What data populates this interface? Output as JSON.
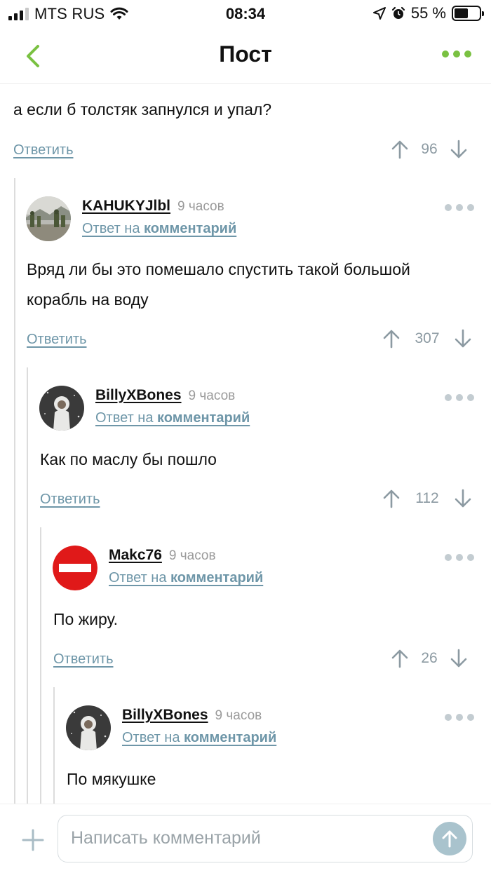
{
  "status_bar": {
    "carrier": "MTS RUS",
    "time": "08:34",
    "battery": "55 %",
    "battery_level": 0.55
  },
  "nav": {
    "title": "Пост"
  },
  "colors": {
    "accent": "#7ac142",
    "link": "#6e96a8",
    "muted": "#8c9aa2"
  },
  "comments": [
    {
      "text": "а если б толстяк запнулся и упал?",
      "reply_label": "Ответить",
      "votes": "96"
    },
    {
      "author": "KAHUKYJlbl",
      "time": "9 часов",
      "reply_to_prefix": "Ответ на ",
      "reply_to_link": "комментарий",
      "text": "Вряд ли бы это помешало спустить такой большой корабль на воду",
      "reply_label": "Ответить",
      "votes": "307"
    },
    {
      "author": "BillyXBones",
      "time": "9 часов",
      "reply_to_prefix": "Ответ на ",
      "reply_to_link": "комментарий",
      "text": "Как по маслу бы пошло",
      "reply_label": "Ответить",
      "votes": "112"
    },
    {
      "author": "Makc76",
      "time": "9 часов",
      "reply_to_prefix": "Ответ на ",
      "reply_to_link": "комментарий",
      "text": "По жиру.",
      "reply_label": "Ответить",
      "votes": "26"
    },
    {
      "author": "BillyXBones",
      "time": "9 часов",
      "reply_to_prefix": "Ответ на ",
      "reply_to_link": "комментарий",
      "text": "По мякушке"
    }
  ],
  "composer": {
    "placeholder": "Написать комментарий"
  }
}
